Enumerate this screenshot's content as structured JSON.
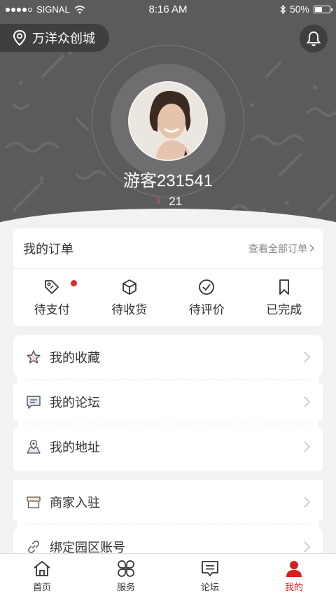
{
  "status_bar": {
    "carrier": "SIGNAL",
    "time": "8:16 AM",
    "battery": "50%"
  },
  "header": {
    "location": "万洋众创城",
    "username": "游客231541",
    "age": "21"
  },
  "orders": {
    "title": "我的订单",
    "view_all": "查看全部订单",
    "items": [
      {
        "label": "待支付",
        "icon": "tag-icon",
        "has_badge": true
      },
      {
        "label": "待收货",
        "icon": "box-icon",
        "has_badge": false
      },
      {
        "label": "待评价",
        "icon": "check-circle-icon",
        "has_badge": false
      },
      {
        "label": "已完成",
        "icon": "bookmark-icon",
        "has_badge": false
      }
    ]
  },
  "menu": {
    "group1": [
      {
        "label": "我的收藏",
        "icon": "star-icon"
      },
      {
        "label": "我的论坛",
        "icon": "chat-icon"
      },
      {
        "label": "我的地址",
        "icon": "map-pin-icon"
      }
    ],
    "group2": [
      {
        "label": "商家入驻",
        "icon": "store-icon"
      },
      {
        "label": "绑定园区账号",
        "icon": "link-icon"
      }
    ]
  },
  "tabbar": {
    "tabs": [
      {
        "label": "首页",
        "icon": "home-icon"
      },
      {
        "label": "服务",
        "icon": "clover-icon"
      },
      {
        "label": "论坛",
        "icon": "forum-icon"
      },
      {
        "label": "我的",
        "icon": "person-icon",
        "active": true
      }
    ]
  },
  "colors": {
    "accent": "#d81e1e",
    "header_bg": "#5b5b5b",
    "badge": "#e02a2a"
  }
}
